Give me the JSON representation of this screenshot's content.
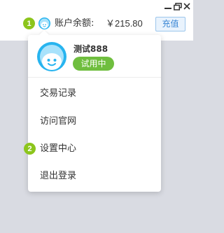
{
  "window_controls": {
    "minimize_icon": "minimize-icon",
    "restore_icon": "restore-icon",
    "close_icon": "close-icon"
  },
  "header": {
    "badge_1": "1",
    "balance_label": "账户余额:",
    "balance_value": "￥215.80",
    "recharge_label": "充值"
  },
  "account": {
    "username": "测试888",
    "status": "试用中"
  },
  "menu": {
    "items": [
      {
        "label": "交易记录"
      },
      {
        "label": "访问官网"
      },
      {
        "label": "设置中心"
      },
      {
        "label": "退出登录"
      }
    ],
    "badge_2": "2"
  },
  "colors": {
    "badge_green": "#8cc51c",
    "status_green": "#6fbe3e",
    "avatar_blue": "#27b4ef",
    "recharge_blue": "#3a86d4"
  }
}
